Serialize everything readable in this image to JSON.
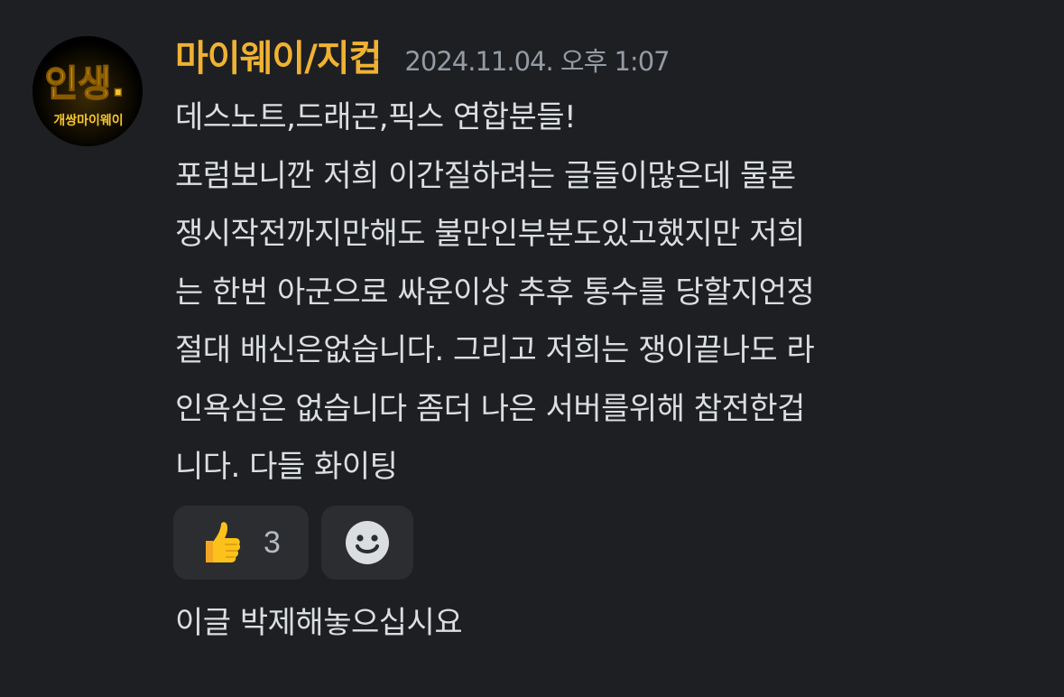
{
  "message": {
    "username": "마이웨이/지컵",
    "timestamp": "2024.11.04. 오후 1:07",
    "avatar": {
      "icon": "server-logo-avatar",
      "text_main": "인생.",
      "text_sub": "개쌍마이웨이"
    },
    "body_lines": [
      "데스노트,드래곤,픽스 연합분들!",
      "포럼보니깐 저희 이간질하려는 글들이많은데 물론",
      "쟁시작전까지만해도 불만인부분도있고했지만 저희",
      "는 한번 아군으로 싸운이상 추후 통수를 당할지언정",
      "절대 배신은없습니다. 그리고 저희는 쟁이끝나도 라",
      "인욕심은 없습니다 좀더 나은 서버를위해 참전한겁",
      "니다. 다들 화이팅"
    ],
    "reactions": [
      {
        "emoji": "thumbs-up-icon",
        "count": "3"
      },
      {
        "emoji": "add-reaction-smiley-icon"
      }
    ]
  },
  "reply": {
    "text": "이글 박제해놓으십시요"
  },
  "colors": {
    "background": "#1e1f22",
    "username": "#f0b232",
    "timestamp": "#949ba4",
    "text": "#dbdee1",
    "reaction_bg": "#2b2d31"
  }
}
